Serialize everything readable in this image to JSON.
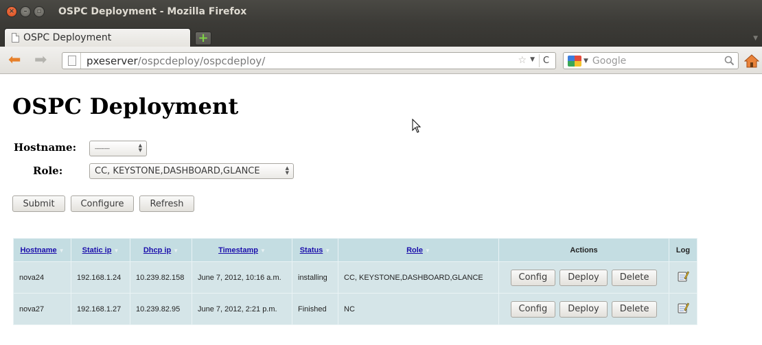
{
  "window": {
    "title": "OSPC Deployment - Mozilla Firefox"
  },
  "tabs": [
    {
      "label": "OSPC Deployment"
    }
  ],
  "navbar": {
    "url_host": "pxeserver",
    "url_path": "/ospcdeploy/ospcdeploy/",
    "search_placeholder": "Google"
  },
  "page": {
    "title": "OSPC Deployment",
    "form": {
      "hostname_label": "Hostname:",
      "hostname_value": "---------",
      "role_label": "Role:",
      "role_value": "CC, KEYSTONE,DASHBOARD,GLANCE"
    },
    "buttons": {
      "submit": "Submit",
      "configure": "Configure",
      "refresh": "Refresh"
    }
  },
  "table": {
    "headers": {
      "hostname": "Hostname",
      "static_ip": "Static ip",
      "dhcp_ip": "Dhcp ip",
      "timestamp": "Timestamp",
      "status": "Status",
      "role": "Role",
      "actions": "Actions",
      "log": "Log"
    },
    "rows": [
      {
        "hostname": "nova24",
        "static_ip": "192.168.1.24",
        "dhcp_ip": "10.239.82.158",
        "timestamp": "June 7, 2012, 10:16 a.m.",
        "status": "installing",
        "role": "CC, KEYSTONE,DASHBOARD,GLANCE"
      },
      {
        "hostname": "nova27",
        "static_ip": "192.168.1.27",
        "dhcp_ip": "10.239.82.95",
        "timestamp": "June 7, 2012, 2:21 p.m.",
        "status": "Finished",
        "role": "NC"
      }
    ],
    "action_labels": {
      "config": "Config",
      "deploy": "Deploy",
      "delete": "Delete"
    }
  },
  "colors": {
    "titlebar": "#3c3b37",
    "close_button": "#e4582b",
    "table_header": "#c4dde2",
    "table_row": "#d5e5e8",
    "header_link": "#1a0dab"
  }
}
